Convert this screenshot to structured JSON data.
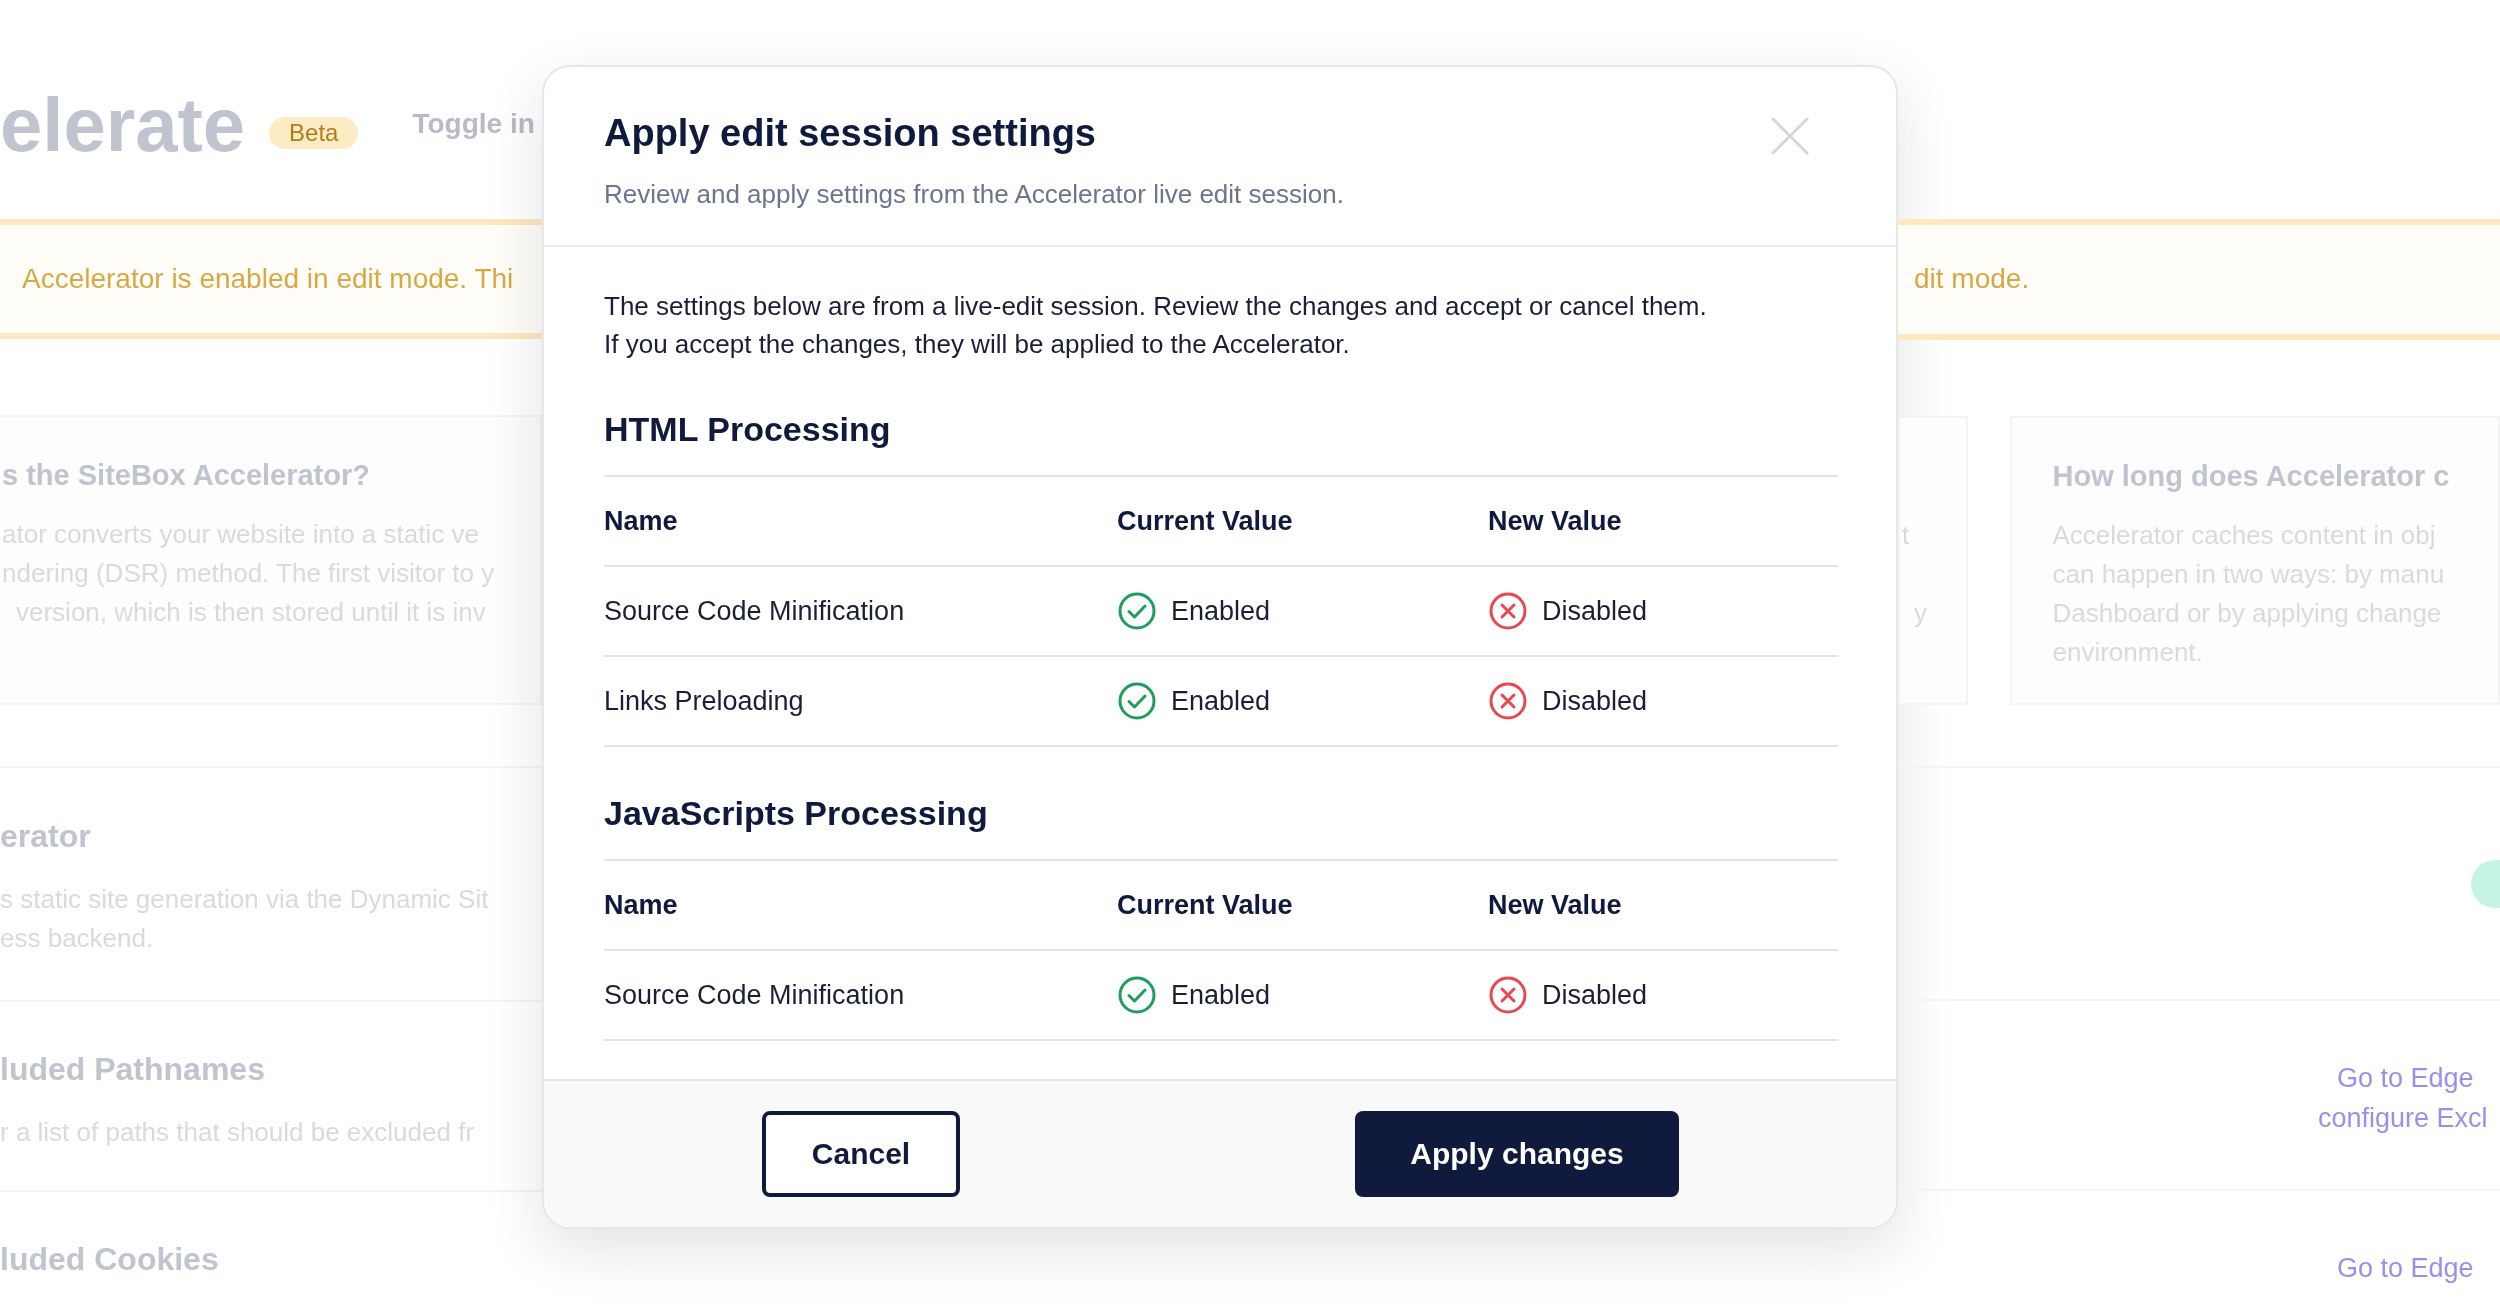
{
  "page": {
    "title": "elerate",
    "badge": "Beta",
    "toggle_label": "Toggle in",
    "banner": {
      "text_left": "Accelerator is enabled in edit mode. Thi",
      "text_right": "dit mode."
    },
    "cards_left": [
      {
        "title": "s the SiteBox Accelerator?",
        "lines": [
          "ator converts your website into a static ve",
          "ndering (DSR) method. The first visitor to y",
          "version, which is then stored until it is inv"
        ]
      }
    ],
    "card_fragments": [
      "t",
      "y"
    ],
    "cards_right": [
      {
        "title": "How long does Accelerator c",
        "lines": [
          "Accelerator caches content in obj",
          "can happen in two ways: by manu",
          "Dashboard or by applying change",
          "environment."
        ]
      }
    ],
    "sections": [
      {
        "title": "erator",
        "description": [
          "s static site generation via the Dynamic Sit",
          "ess backend."
        ],
        "toggle": {
          "on": true
        }
      },
      {
        "title": "luded Pathnames",
        "description": [
          "r a list of paths that should be excluded fr"
        ],
        "link": [
          "Go to Edge",
          "configure Excl"
        ]
      },
      {
        "title": "luded Cookies",
        "link": [
          "Go to Edge"
        ]
      }
    ]
  },
  "dialog": {
    "title": "Apply edit session settings",
    "subtitle": "Review and apply settings from the Accelerator live edit session.",
    "intro": "The settings below are from a live-edit session. Review the changes and accept or cancel them. If you accept the changes, they will be applied to the Accelerator.",
    "groups": [
      {
        "title": "HTML Processing",
        "columns": [
          "Name",
          "Current Value",
          "New Value"
        ],
        "rows": [
          {
            "name": "Source Code Minification",
            "current": {
              "text": "Enabled",
              "enabled": true
            },
            "new": {
              "text": "Disabled",
              "enabled": false
            }
          },
          {
            "name": "Links Preloading",
            "current": {
              "text": "Enabled",
              "enabled": true
            },
            "new": {
              "text": "Disabled",
              "enabled": false
            }
          }
        ]
      },
      {
        "title": "JavaScripts Processing",
        "columns": [
          "Name",
          "Current Value",
          "New Value"
        ],
        "rows": [
          {
            "name": "Source Code Minification",
            "current": {
              "text": "Enabled",
              "enabled": true
            },
            "new": {
              "text": "Disabled",
              "enabled": false
            }
          }
        ]
      }
    ],
    "buttons": [
      {
        "label": "Cancel",
        "kind": "secondary"
      },
      {
        "label": "Apply changes",
        "kind": "primary"
      }
    ]
  }
}
